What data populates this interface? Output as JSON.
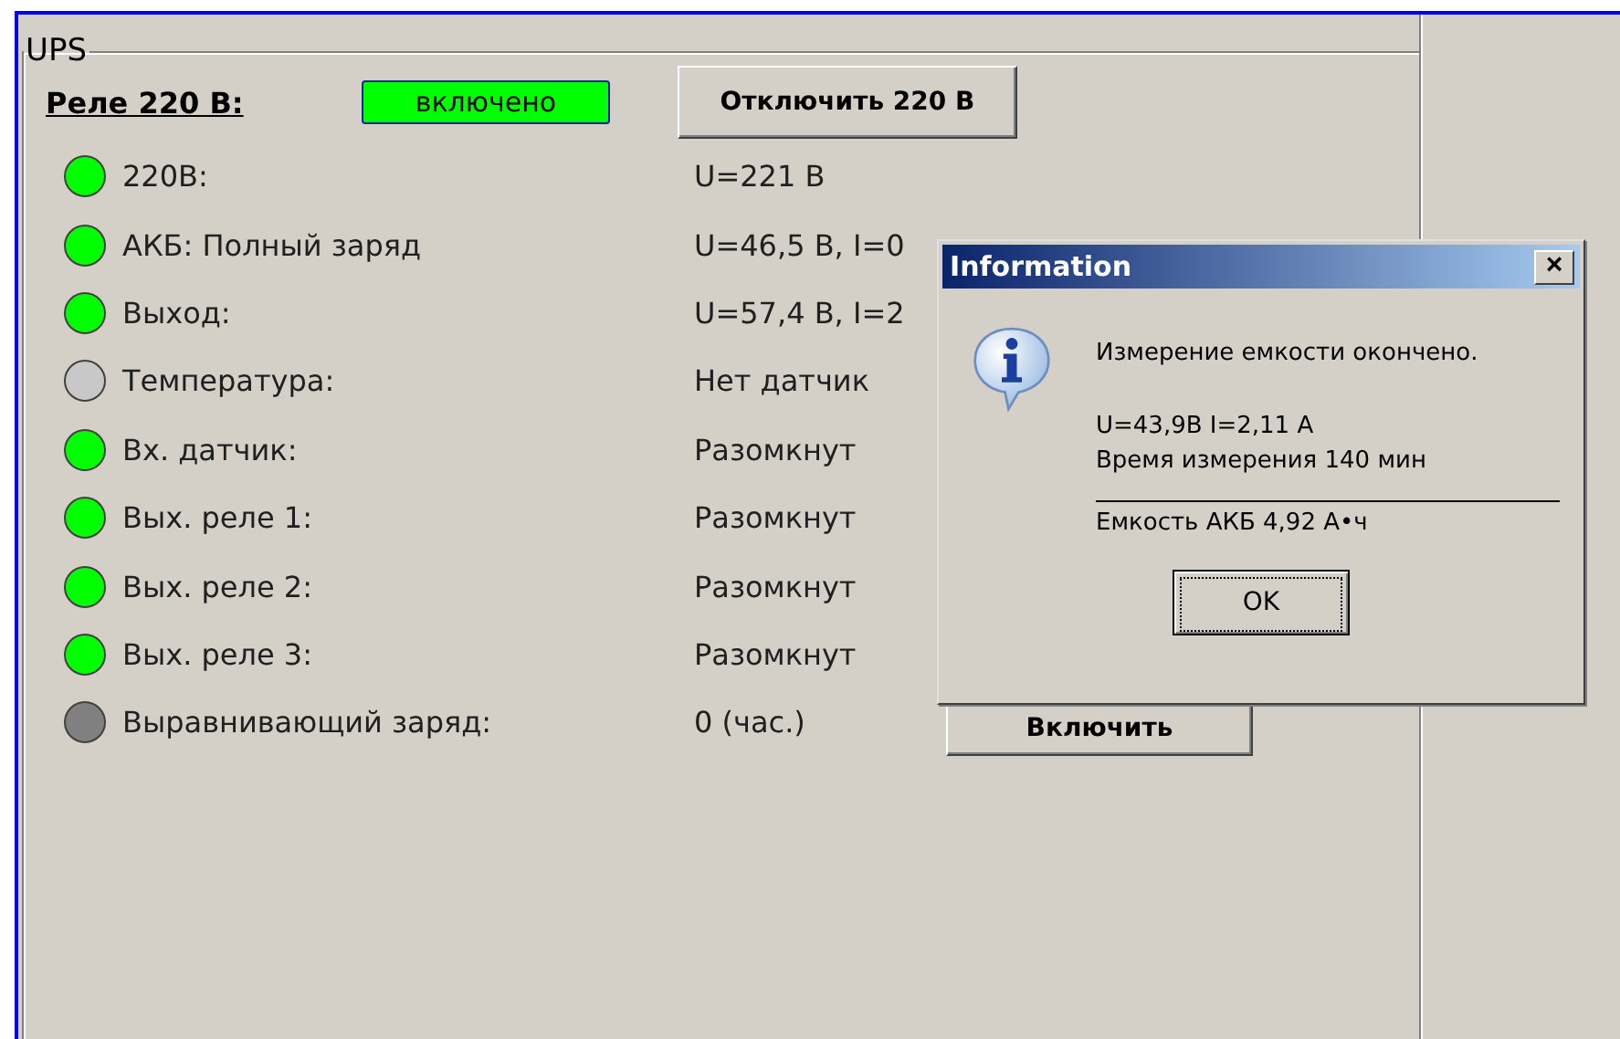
{
  "group": {
    "title": "UPS"
  },
  "relay": {
    "label": "Реле 220 В:",
    "status": "включено",
    "on": true,
    "button": "Отключить 220 В"
  },
  "rows": [
    {
      "label": "220В:",
      "value": "U=221 В",
      "color": "#00ff00"
    },
    {
      "label": "АКБ: Полный заряд",
      "value": "U=46,5 В,  I=0",
      "color": "#00ff00"
    },
    {
      "label": "Выход:",
      "value": "U=57,4 В,  I=2",
      "color": "#00ff00"
    },
    {
      "label": "Температура:",
      "value": "Нет датчик",
      "color": "#c8c8c8"
    },
    {
      "label": "Вх. датчик:",
      "value": "Разомкнут",
      "color": "#00ff00"
    },
    {
      "label": "Вых. реле 1:",
      "value": "Разомкнут",
      "color": "#00ff00"
    },
    {
      "label": "Вых. реле 2:",
      "value": "Разомкнут",
      "color": "#00ff00"
    },
    {
      "label": "Вых. реле 3:",
      "value": "Разомкнут",
      "color": "#00ff00"
    },
    {
      "label": "Выравнивающий заряд:",
      "value": "0 (час.)",
      "color": "#808080",
      "button": "Включить"
    }
  ],
  "dialog": {
    "title": "Information",
    "close": "×",
    "lines": [
      "Измерение емкости окончено.",
      "U=43,9В I=2,11 А",
      "Время измерения 140 мин"
    ],
    "footer": "Емкость АКБ 4,92 А•ч",
    "button": "OK"
  }
}
